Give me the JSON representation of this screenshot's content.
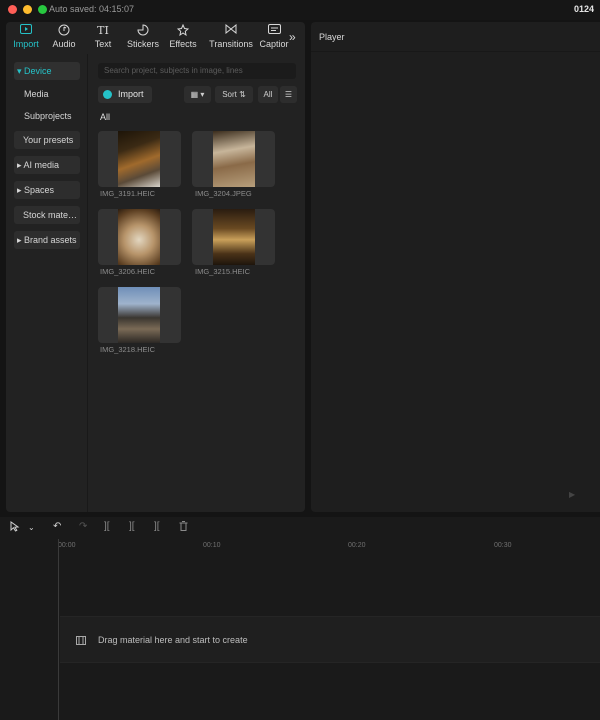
{
  "titlebar": {
    "autosave": "Auto saved: 04:15:07",
    "project": "0124"
  },
  "toolbar": {
    "tabs": [
      {
        "label": "Import",
        "icon": "import-icon"
      },
      {
        "label": "Audio",
        "icon": "audio-icon"
      },
      {
        "label": "Text",
        "icon": "text-icon"
      },
      {
        "label": "Stickers",
        "icon": "stickers-icon"
      },
      {
        "label": "Effects",
        "icon": "effects-icon"
      },
      {
        "label": "Transitions",
        "icon": "transitions-icon"
      },
      {
        "label": "Captior",
        "icon": "captions-icon"
      }
    ],
    "text_glyph": "TI",
    "more_glyph": "»"
  },
  "sidenav": {
    "device": "▾ Device",
    "media": "Media",
    "subprojects": "Subprojects",
    "your_presets": "Your presets",
    "ai_media": "▸ AI media",
    "spaces": "▸ Spaces",
    "stock": "Stock mate…",
    "brand_assets": "▸ Brand assets"
  },
  "media": {
    "search_placeholder": "Search project, subjects in image, lines",
    "import_label": "Import",
    "sort_label": "Sort ⇅",
    "all_filter": "All",
    "all_label": "All",
    "items": [
      {
        "name": "IMG_3191.HEIC"
      },
      {
        "name": "IMG_3204.JPEG"
      },
      {
        "name": "IMG_3206.HEIC"
      },
      {
        "name": "IMG_3215.HEIC"
      },
      {
        "name": "IMG_3218.HEIC"
      }
    ]
  },
  "player": {
    "title": "Player"
  },
  "timeline": {
    "ticks": [
      "00:00",
      "00:10",
      "00:20",
      "00:30"
    ],
    "drag_hint": "Drag material here and start to create"
  },
  "colors": {
    "accent": "#25c2c8",
    "panel": "#222222",
    "background": "#141414"
  }
}
